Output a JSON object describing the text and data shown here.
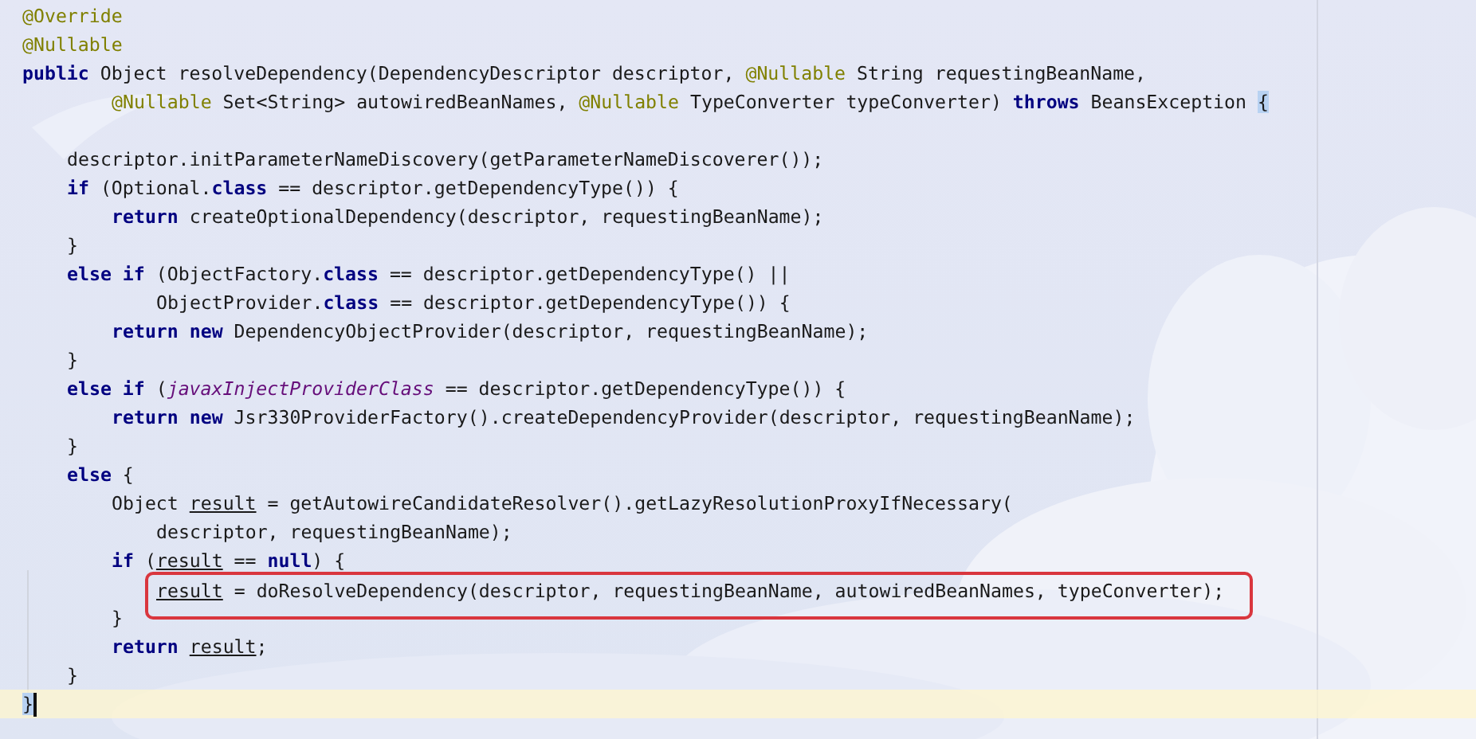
{
  "editor": {
    "lines": [
      {
        "kind": "code",
        "highlighted": false,
        "current": false,
        "tokens": [
          {
            "kind": "annotation",
            "text": "@Override"
          }
        ]
      },
      {
        "kind": "code",
        "highlighted": false,
        "current": false,
        "tokens": [
          {
            "kind": "annotation",
            "text": "@Nullable"
          }
        ]
      },
      {
        "kind": "code",
        "highlighted": false,
        "current": false,
        "tokens": [
          {
            "kind": "keyword",
            "text": "public"
          },
          {
            "kind": "plain",
            "text": " Object resolveDependency(DependencyDescriptor descriptor, "
          },
          {
            "kind": "annotation",
            "text": "@Nullable"
          },
          {
            "kind": "plain",
            "text": " String requestingBeanName,"
          }
        ],
        "children": [
          {
            "kind": "continuation",
            "highlighted": false,
            "current": false,
            "tokens": [
              {
                "kind": "annotation",
                "text": "@Nullable"
              },
              {
                "kind": "plain",
                "text": " Set<String> autowiredBeanNames, "
              },
              {
                "kind": "annotation",
                "text": "@Nullable"
              },
              {
                "kind": "plain",
                "text": " TypeConverter typeConverter) "
              },
              {
                "kind": "keyword",
                "text": "throws"
              },
              {
                "kind": "plain",
                "text": " BeansException "
              },
              {
                "kind": "brace-match",
                "text": "{"
              }
            ]
          },
          {
            "kind": "blank"
          },
          {
            "kind": "code",
            "highlighted": false,
            "current": false,
            "tokens": [
              {
                "kind": "plain",
                "text": "descriptor.initParameterNameDiscovery(getParameterNameDiscoverer());"
              }
            ]
          },
          {
            "kind": "code",
            "highlighted": false,
            "current": false,
            "tokens": [
              {
                "kind": "keyword",
                "text": "if"
              },
              {
                "kind": "plain",
                "text": " (Optional."
              },
              {
                "kind": "keyword",
                "text": "class"
              },
              {
                "kind": "plain",
                "text": " == descriptor.getDependencyType()) {"
              }
            ],
            "children": [
              {
                "kind": "code",
                "highlighted": false,
                "current": false,
                "tokens": [
                  {
                    "kind": "keyword",
                    "text": "return"
                  },
                  {
                    "kind": "plain",
                    "text": " createOptionalDependency(descriptor, requestingBeanName);"
                  }
                ]
              }
            ]
          },
          {
            "kind": "code",
            "highlighted": false,
            "current": false,
            "tokens": [
              {
                "kind": "plain",
                "text": "}"
              }
            ]
          },
          {
            "kind": "code",
            "highlighted": false,
            "current": false,
            "tokens": [
              {
                "kind": "keyword",
                "text": "else if"
              },
              {
                "kind": "plain",
                "text": " (ObjectFactory."
              },
              {
                "kind": "keyword",
                "text": "class"
              },
              {
                "kind": "plain",
                "text": " == descriptor.getDependencyType() ||"
              }
            ],
            "children": [
              {
                "kind": "continuation",
                "highlighted": false,
                "current": false,
                "tokens": [
                  {
                    "kind": "plain",
                    "text": "ObjectProvider."
                  },
                  {
                    "kind": "keyword",
                    "text": "class"
                  },
                  {
                    "kind": "plain",
                    "text": " == descriptor.getDependencyType()) {"
                  }
                ]
              },
              {
                "kind": "code",
                "highlighted": false,
                "current": false,
                "tokens": [
                  {
                    "kind": "keyword",
                    "text": "return new"
                  },
                  {
                    "kind": "plain",
                    "text": " DependencyObjectProvider(descriptor, requestingBeanName);"
                  }
                ]
              }
            ]
          },
          {
            "kind": "code",
            "highlighted": false,
            "current": false,
            "tokens": [
              {
                "kind": "plain",
                "text": "}"
              }
            ]
          },
          {
            "kind": "code",
            "highlighted": false,
            "current": false,
            "tokens": [
              {
                "kind": "keyword",
                "text": "else if"
              },
              {
                "kind": "plain",
                "text": " ("
              },
              {
                "kind": "field",
                "text": "javaxInjectProviderClass"
              },
              {
                "kind": "plain",
                "text": " == descriptor.getDependencyType()) {"
              }
            ],
            "children": [
              {
                "kind": "code",
                "highlighted": false,
                "current": false,
                "tokens": [
                  {
                    "kind": "keyword",
                    "text": "return new"
                  },
                  {
                    "kind": "plain",
                    "text": " Jsr330ProviderFactory().createDependencyProvider(descriptor, requestingBeanName);"
                  }
                ]
              }
            ]
          },
          {
            "kind": "code",
            "highlighted": false,
            "current": false,
            "tokens": [
              {
                "kind": "plain",
                "text": "}"
              }
            ]
          },
          {
            "kind": "code",
            "highlighted": false,
            "current": false,
            "tokens": [
              {
                "kind": "keyword",
                "text": "else"
              },
              {
                "kind": "plain",
                "text": " {"
              }
            ],
            "children": [
              {
                "kind": "code",
                "highlighted": false,
                "current": false,
                "tokens": [
                  {
                    "kind": "plain",
                    "text": "Object "
                  },
                  {
                    "kind": "variable",
                    "text": "result"
                  },
                  {
                    "kind": "plain",
                    "text": " = getAutowireCandidateResolver().getLazyResolutionProxyIfNecessary("
                  }
                ],
                "children": [
                  {
                    "kind": "code",
                    "highlighted": false,
                    "current": false,
                    "tokens": [
                      {
                        "kind": "plain",
                        "text": "descriptor, requestingBeanName);"
                      }
                    ]
                  }
                ]
              },
              {
                "kind": "code",
                "highlighted": false,
                "current": false,
                "tokens": [
                  {
                    "kind": "keyword",
                    "text": "if"
                  },
                  {
                    "kind": "plain",
                    "text": " ("
                  },
                  {
                    "kind": "variable",
                    "text": "result"
                  },
                  {
                    "kind": "plain",
                    "text": " == "
                  },
                  {
                    "kind": "keyword",
                    "text": "null"
                  },
                  {
                    "kind": "plain",
                    "text": ") {"
                  }
                ],
                "children": [
                  {
                    "kind": "code",
                    "highlighted": true,
                    "current": false,
                    "tokens": [
                      {
                        "kind": "variable",
                        "text": "result"
                      },
                      {
                        "kind": "plain",
                        "text": " = doResolveDependency(descriptor, requestingBeanName, autowiredBeanNames, typeConverter);"
                      }
                    ]
                  }
                ]
              },
              {
                "kind": "code",
                "highlighted": false,
                "current": false,
                "tokens": [
                  {
                    "kind": "plain",
                    "text": "}"
                  }
                ]
              },
              {
                "kind": "code",
                "highlighted": false,
                "current": false,
                "tokens": [
                  {
                    "kind": "keyword",
                    "text": "return "
                  },
                  {
                    "kind": "variable",
                    "text": "result"
                  },
                  {
                    "kind": "plain",
                    "text": ";"
                  }
                ]
              }
            ]
          },
          {
            "kind": "code",
            "highlighted": false,
            "current": false,
            "tokens": [
              {
                "kind": "plain",
                "text": "}"
              }
            ]
          }
        ]
      },
      {
        "kind": "code",
        "highlighted": false,
        "current": true,
        "tokens": [
          {
            "kind": "brace-match",
            "text": "}"
          }
        ]
      }
    ]
  }
}
